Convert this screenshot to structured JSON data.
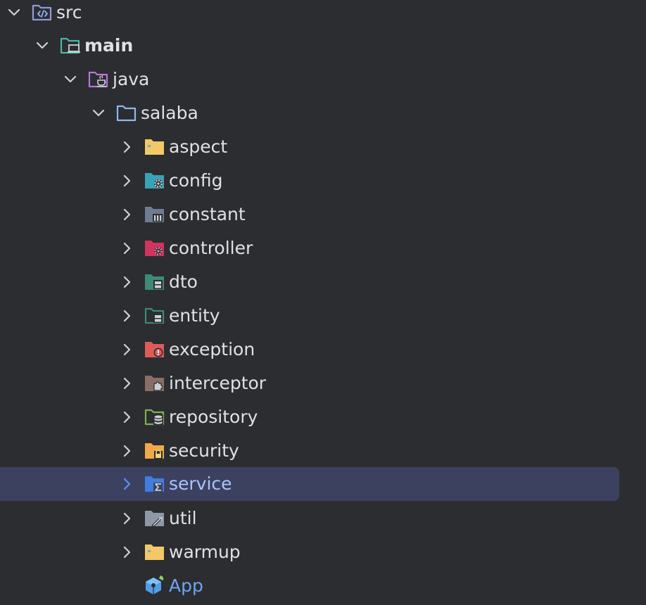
{
  "tree": {
    "src": {
      "label": "src",
      "icon": "source-root-folder-icon",
      "expanded": true
    },
    "main": {
      "label": "main",
      "icon": "module-folder-icon",
      "expanded": true
    },
    "java": {
      "label": "java",
      "icon": "java-source-folder-icon",
      "expanded": true
    },
    "salaba": {
      "label": "salaba",
      "icon": "package-folder-icon",
      "expanded": true
    },
    "packages": [
      {
        "label": "aspect",
        "icon": "aspect-folder-icon",
        "expanded": false,
        "selected": false
      },
      {
        "label": "config",
        "icon": "config-folder-icon",
        "expanded": false,
        "selected": false
      },
      {
        "label": "constant",
        "icon": "constant-folder-icon",
        "expanded": false,
        "selected": false
      },
      {
        "label": "controller",
        "icon": "controller-folder-icon",
        "expanded": false,
        "selected": false
      },
      {
        "label": "dto",
        "icon": "dto-folder-icon",
        "expanded": false,
        "selected": false
      },
      {
        "label": "entity",
        "icon": "entity-folder-icon",
        "expanded": false,
        "selected": false
      },
      {
        "label": "exception",
        "icon": "exception-folder-icon",
        "expanded": false,
        "selected": false
      },
      {
        "label": "interceptor",
        "icon": "interceptor-folder-icon",
        "expanded": false,
        "selected": false
      },
      {
        "label": "repository",
        "icon": "repository-folder-icon",
        "expanded": false,
        "selected": false
      },
      {
        "label": "security",
        "icon": "security-folder-icon",
        "expanded": false,
        "selected": false
      },
      {
        "label": "service",
        "icon": "service-folder-icon",
        "expanded": false,
        "selected": true
      },
      {
        "label": "util",
        "icon": "util-folder-icon",
        "expanded": false,
        "selected": false
      },
      {
        "label": "warmup",
        "icon": "warmup-folder-icon",
        "expanded": false,
        "selected": false
      }
    ],
    "app": {
      "label": "App",
      "icon": "spring-app-class-icon"
    }
  },
  "colors": {
    "background": "#2b2d30",
    "selection": "#3d4160",
    "text": "#dfe1e5",
    "selected_text": "#a9c4ff",
    "app_text": "#6fa4f2"
  }
}
